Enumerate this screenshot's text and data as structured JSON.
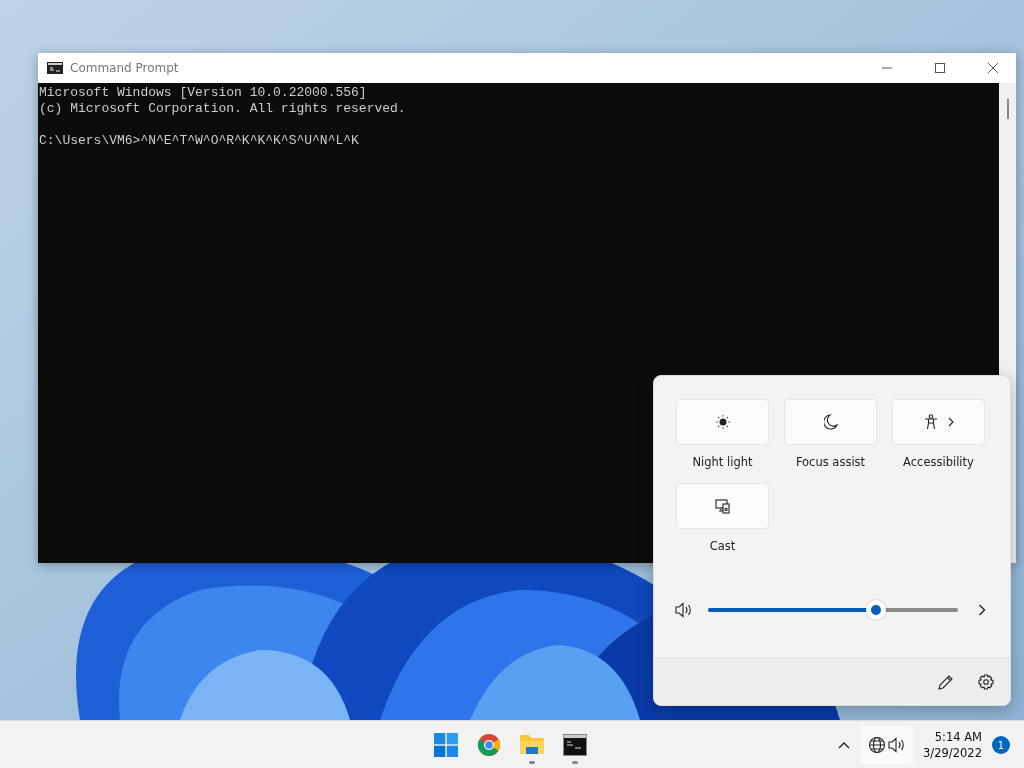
{
  "window": {
    "title": "Command Prompt",
    "output": [
      "Microsoft Windows [Version 10.0.22000.556]",
      "(c) Microsoft Corporation. All rights reserved."
    ],
    "prompt": "C:\\Users\\VM6>^N^E^T^W^O^R^K^K^K^S^U^N^L^K"
  },
  "quick_settings": {
    "tiles": [
      {
        "kind": "night_light",
        "label": "Night light",
        "on": false,
        "expandable": false
      },
      {
        "kind": "focus_assist",
        "label": "Focus assist",
        "on": false,
        "expandable": false
      },
      {
        "kind": "accessibility",
        "label": "Accessibility",
        "on": false,
        "expandable": true
      },
      {
        "kind": "cast",
        "label": "Cast",
        "on": false,
        "expandable": false
      }
    ],
    "volume": {
      "level": 0.67
    }
  },
  "taskbar": {
    "apps": [
      {
        "kind": "start",
        "running": false
      },
      {
        "kind": "browser",
        "running": false
      },
      {
        "kind": "files",
        "running": true
      },
      {
        "kind": "terminal",
        "running": true
      }
    ],
    "time": "5:14 AM",
    "date": "3/29/2022",
    "notifications": "1"
  }
}
